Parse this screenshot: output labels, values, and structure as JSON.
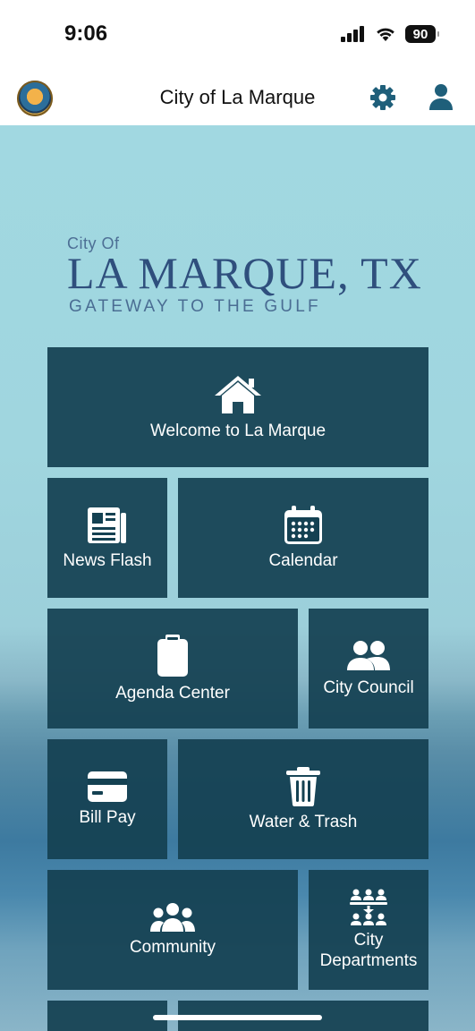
{
  "status_bar": {
    "time": "9:06",
    "battery": "90"
  },
  "header": {
    "title": "City of La Marque",
    "icons": [
      "city-seal-logo",
      "gear-icon",
      "user-icon"
    ]
  },
  "brand": {
    "city_of": "City Of",
    "name": "LA MARQUE, TX",
    "tagline": "GATEWAY TO THE GULF"
  },
  "tiles": [
    {
      "label": "Welcome to La Marque",
      "icon": "home-icon"
    },
    {
      "label": "News Flash",
      "icon": "newspaper-icon"
    },
    {
      "label": "Calendar",
      "icon": "calendar-icon"
    },
    {
      "label": "Agenda Center",
      "icon": "clipboard-icon"
    },
    {
      "label": "City Council",
      "icon": "users-icon"
    },
    {
      "label": "Bill Pay",
      "icon": "credit-card-icon"
    },
    {
      "label": "Water & Trash",
      "icon": "trash-icon"
    },
    {
      "label": "Community",
      "icon": "people-group-icon"
    },
    {
      "label": "City Departments",
      "icon": "departments-icon"
    }
  ],
  "colors": {
    "tile_background": "#144152",
    "header_accent": "#1f5f7a",
    "content_background": "#a1d8e1"
  }
}
